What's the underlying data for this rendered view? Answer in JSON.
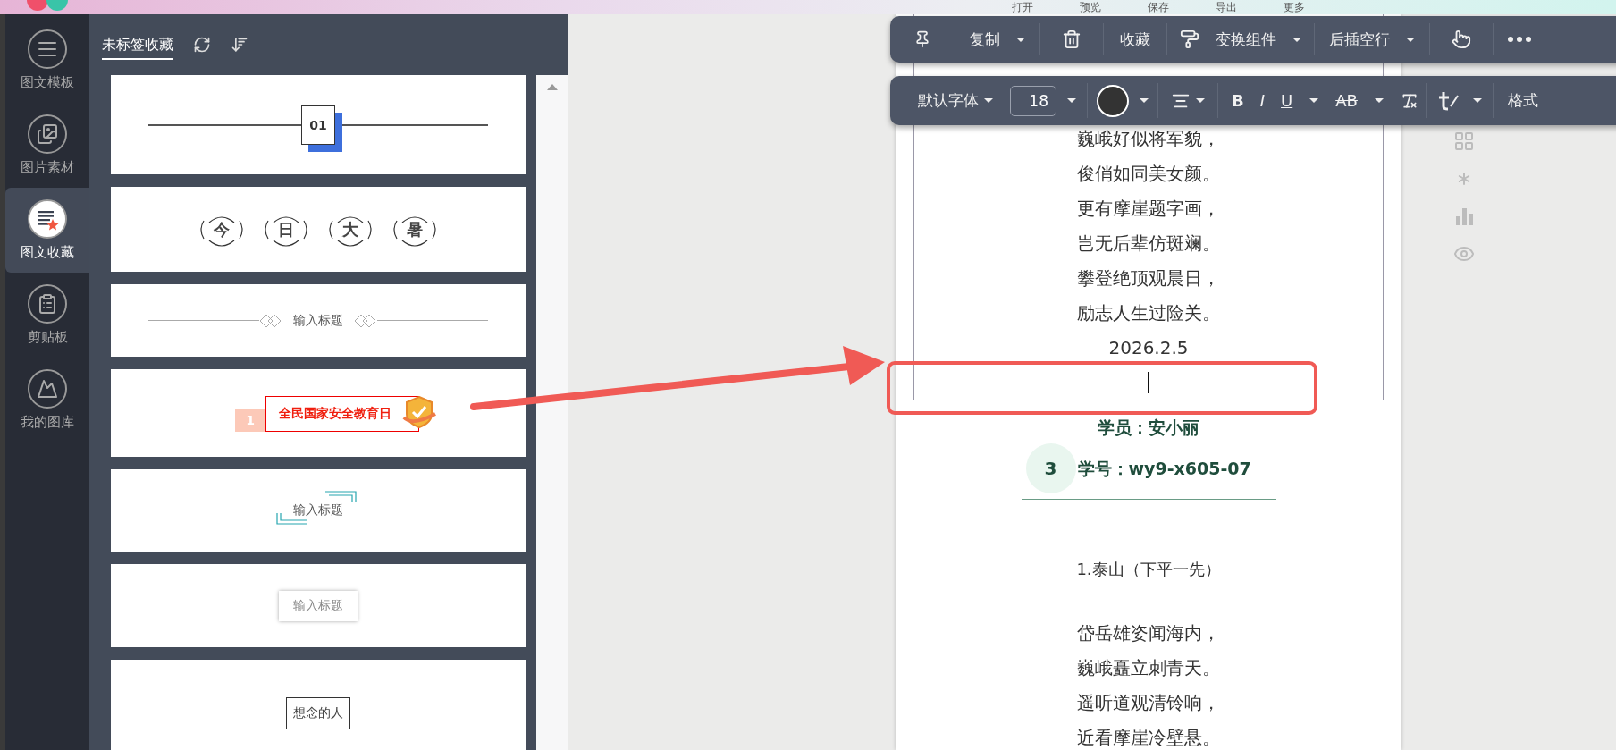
{
  "menu": [
    "打开",
    "预览",
    "保存",
    "导出",
    "更多"
  ],
  "rail": [
    {
      "label": "图文模板",
      "selected": false
    },
    {
      "label": "图片素材",
      "selected": false
    },
    {
      "label": "图文收藏",
      "selected": true
    },
    {
      "label": "剪贴板",
      "selected": false
    },
    {
      "label": "我的图库",
      "selected": false
    }
  ],
  "panel": {
    "tab": "未标签收藏",
    "cards": [
      {
        "kind": "number-divider",
        "text": "01"
      },
      {
        "kind": "char-circles",
        "chars": [
          "今",
          "日",
          "大",
          "暑"
        ]
      },
      {
        "kind": "diamond-divider",
        "text": "输入标题"
      },
      {
        "kind": "ribbon-badge",
        "number": "1",
        "text": "全民国家安全教育日"
      },
      {
        "kind": "corner-brackets",
        "text": "输入标题"
      },
      {
        "kind": "shadow-box",
        "text": "输入标题"
      },
      {
        "kind": "framed",
        "text": "想念的人"
      }
    ]
  },
  "action_bar": {
    "copy": "复制",
    "favorite": "收藏",
    "transform": "变换组件",
    "insert_after": "后插空行"
  },
  "format_bar": {
    "font": "默认字体",
    "size": "18",
    "color": "#333333",
    "bold": "B",
    "italic": "I",
    "underline": "U",
    "strike": "AB",
    "format": "格式"
  },
  "document": {
    "top_lines": [
      "巍峨好似将军貌，",
      "俊俏如同美女颜。",
      "更有摩崖题字画，",
      "岂无后辈仿斑斓。",
      "攀登绝顶观晨日，",
      "励志人生过险关。"
    ],
    "date": "2026.2.5",
    "student": {
      "name_line": "学员：安小丽",
      "number": "3",
      "id_line": "学号：wy9-x605-07"
    },
    "title": "1.泰山（下平一先）",
    "poem": [
      "岱岳雄姿闻海内，",
      "巍峨矗立刺青天。",
      "遥听道观清铃响，",
      "近看摩崖冷壁悬。"
    ]
  }
}
